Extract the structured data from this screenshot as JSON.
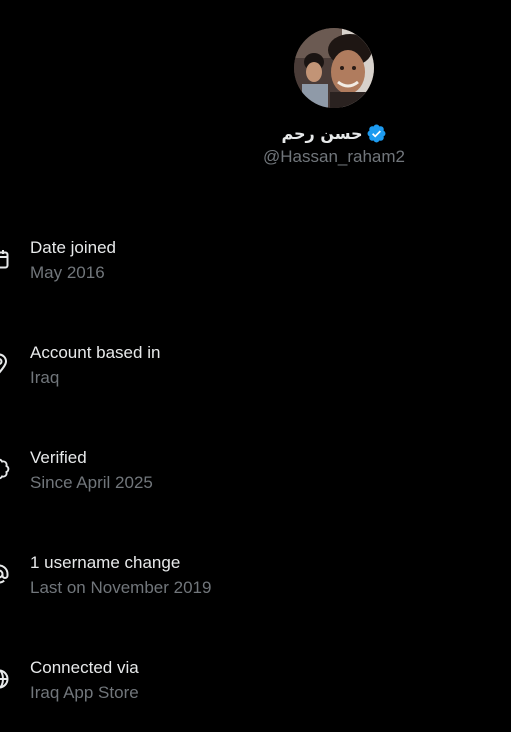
{
  "profile": {
    "display_name": "حسن رحم",
    "handle": "@Hassan_raham2",
    "verified_badge_color": "#1d9bf0",
    "avatar_icon": "profile-photo"
  },
  "about": {
    "items": [
      {
        "icon": "calendar-icon",
        "title": "Date joined",
        "value": "May 2016"
      },
      {
        "icon": "location-pin-icon",
        "title": "Account based in",
        "value": "Iraq"
      },
      {
        "icon": "verified-badge-icon",
        "title": "Verified",
        "value": "Since April 2025"
      },
      {
        "icon": "at-sign-icon",
        "title": "1 username change",
        "value": "Last on November 2019"
      },
      {
        "icon": "globe-icon",
        "title": "Connected via",
        "value": "Iraq App Store"
      }
    ]
  },
  "colors": {
    "background": "#000000",
    "primary_text": "#e7e9ea",
    "secondary_text": "#71767b"
  }
}
